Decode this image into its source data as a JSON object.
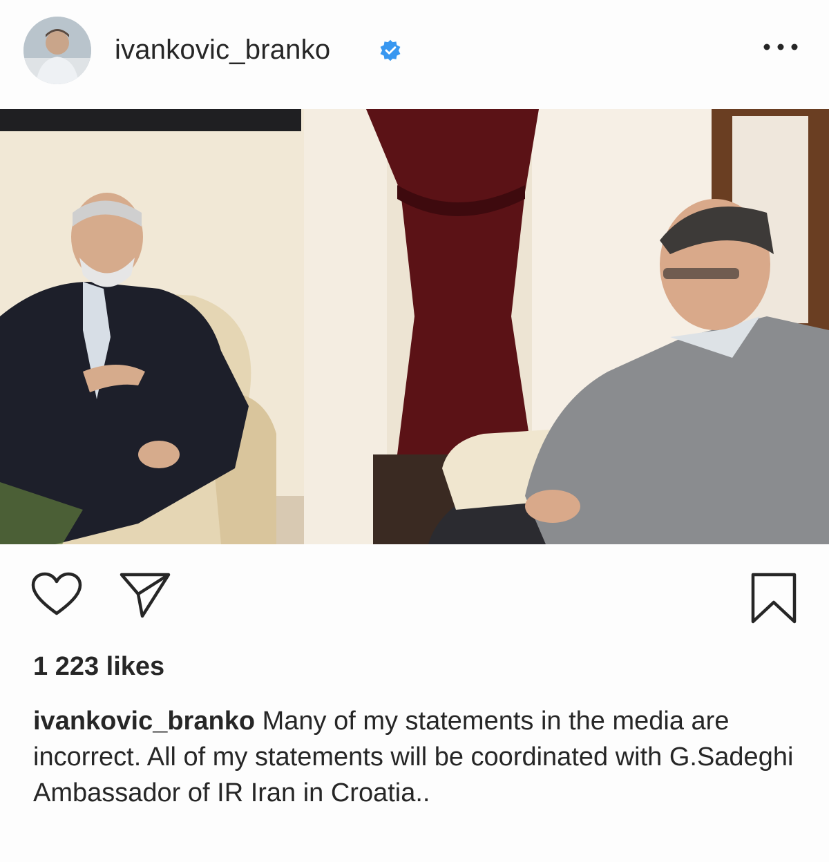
{
  "post": {
    "username": "ivankovic_branko",
    "verified": true,
    "likes_text": "1 223 likes",
    "caption_user": "ivankovic_branko",
    "caption_text": "Many of my statements in the media are incorrect.  All of my statements will be coordinated with G.Sadeghi Ambassador of IR Iran in Croatia.."
  },
  "icons": {
    "avatar": "avatar",
    "verified": "verified-badge-icon",
    "more": "more-options-icon",
    "like": "heart-icon",
    "share": "paper-plane-icon",
    "save": "bookmark-icon"
  },
  "colors": {
    "verified_blue": "#3897f0",
    "text": "#262626",
    "background": "#fdfdfd"
  }
}
